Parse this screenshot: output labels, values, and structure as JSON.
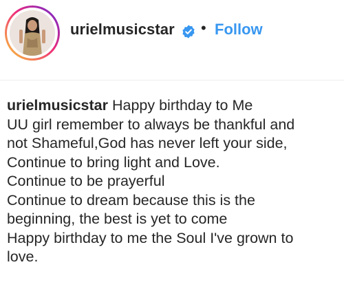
{
  "post": {
    "username": "urielmusicstar",
    "separator": "•",
    "follow_label": "Follow",
    "verified_icon": "verified-badge-icon",
    "accent_color": "#3897f0"
  },
  "caption": {
    "author": "urielmusicstar",
    "lines": [
      "Happy birthday to Me",
      "UU girl remember to always be thankful and",
      "not Shameful,God has never left your side,",
      "Continue to bring light and Love.",
      "Continue to be prayerful",
      "Continue to dream because this is the",
      "beginning, the best is yet to come",
      "Happy birthday to me the Soul I've grown to",
      "love."
    ]
  }
}
